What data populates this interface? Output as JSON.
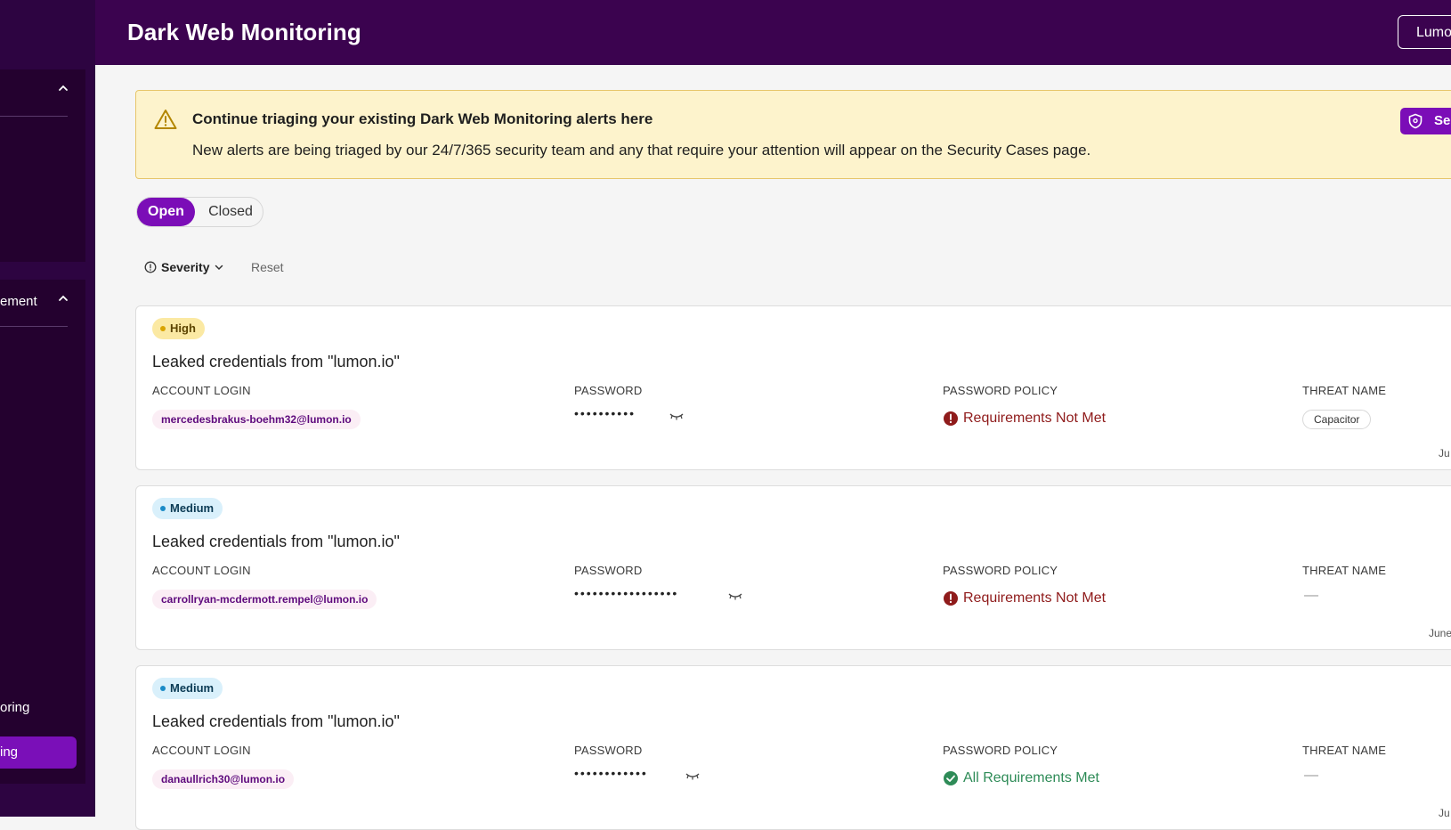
{
  "sidebar": {
    "section_top": {
      "label": ""
    },
    "section_mid": {
      "label": "ement"
    },
    "items": [
      {
        "label": "oring",
        "active": false
      },
      {
        "label": "ing",
        "active": true
      }
    ]
  },
  "header": {
    "title": "Dark Web Monitoring",
    "org_button": "Lumo"
  },
  "banner": {
    "heading": "Continue triaging your existing Dark Web Monitoring alerts here",
    "body": "New alerts are being triaged by our 24/7/365 security team and any that require your attention will appear on the Security Cases page.",
    "button_label": "Se"
  },
  "status_toggle": {
    "open": "Open",
    "closed": "Closed",
    "selected": "Open"
  },
  "filters": {
    "severity": "Severity",
    "reset": "Reset"
  },
  "columns": {
    "login": "ACCOUNT LOGIN",
    "password": "PASSWORD",
    "policy": "PASSWORD POLICY",
    "threat": "THREAT NAME"
  },
  "alerts": [
    {
      "severity": "High",
      "title": "Leaked credentials from \"lumon.io\"",
      "login": "mercedesbrakus-boehm32@lumon.io",
      "password_mask": "••••••••••",
      "policy": "Requirements Not Met",
      "threat": "Capacitor",
      "date": "Ju"
    },
    {
      "severity": "Medium",
      "title": "Leaked credentials from \"lumon.io\"",
      "login": "carrollryan-mcdermott.rempel@lumon.io",
      "password_mask": "•••••••••••••••••",
      "policy": "Requirements Not Met",
      "threat": "—",
      "date": "June"
    },
    {
      "severity": "Medium",
      "title": "Leaked credentials from \"lumon.io\"",
      "login": "danaullrich30@lumon.io",
      "password_mask": "••••••••••••",
      "policy": "All Requirements Met",
      "threat": "—",
      "date": "Ju"
    }
  ],
  "colors": {
    "sidebar_bg": "#2d0441",
    "header_bg": "#3b034f",
    "accent": "#7b0db7",
    "banner_bg": "#fdf3cc",
    "fail": "#8f1b1b",
    "pass": "#2e8b57"
  },
  "icons": {
    "warning": "warning-triangle-icon",
    "shield": "shield-icon",
    "info": "info-circle-icon",
    "chevron": "chevron-down-icon",
    "eye": "eye-closed-icon",
    "fail": "alert-circle-icon",
    "pass": "check-circle-icon"
  }
}
